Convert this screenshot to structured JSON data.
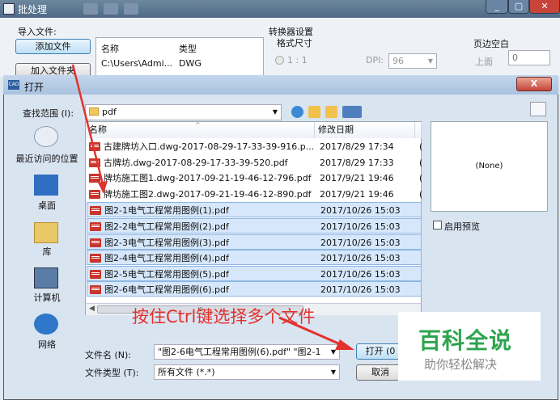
{
  "main_window": {
    "title": "批处理",
    "import_group_label": "导入文件:",
    "add_file_button": "添加文件",
    "add_folder_button": "加入文件夹",
    "list_headers": {
      "name": "名称",
      "type": "类型"
    },
    "list_rows": [
      {
        "name": "C:\\Users\\Admi...",
        "type": "DWG"
      }
    ],
    "converter_group_label": "转换器设置",
    "format_size_label": "格式尺寸",
    "ratio_label": "1 : 1",
    "dpi_label": "DPI:",
    "dpi_value": "96",
    "margin_label": "页边空白",
    "margin_top_label": "上面",
    "margin_top_value": "0"
  },
  "dialog": {
    "title": "打开",
    "close_label": "X",
    "lookin_label": "查找范围 (I):",
    "lookin_value": "pdf",
    "places": [
      {
        "label": "最近访问的位置",
        "icon": "recent-places-icon"
      },
      {
        "label": "桌面",
        "icon": "desktop-icon"
      },
      {
        "label": "库",
        "icon": "libraries-icon"
      },
      {
        "label": "计算机",
        "icon": "computer-icon"
      },
      {
        "label": "网络",
        "icon": "network-icon"
      }
    ],
    "columns": {
      "name": "名称",
      "date": "修改日期"
    },
    "files": [
      {
        "name": "古建牌坊入口.dwg-2017-08-29-17-33-39-916.p...",
        "date": "2017/8/29 17:34",
        "selected": false
      },
      {
        "name": "古牌坊.dwg-2017-08-29-17-33-39-520.pdf",
        "date": "2017/8/29 17:33",
        "selected": false
      },
      {
        "name": "牌坊施工图1.dwg-2017-09-21-19-46-12-796.pdf",
        "date": "2017/9/21 19:46",
        "selected": false
      },
      {
        "name": "牌坊施工图2.dwg-2017-09-21-19-46-12-890.pdf",
        "date": "2017/9/21 19:46",
        "selected": false
      },
      {
        "name": "图2-1电气工程常用图例(1).pdf",
        "date": "2017/10/26 15:03",
        "selected": true
      },
      {
        "name": "图2-2电气工程常用图例(2).pdf",
        "date": "2017/10/26 15:03",
        "selected": true
      },
      {
        "name": "图2-3电气工程常用图例(3).pdf",
        "date": "2017/10/26 15:03",
        "selected": true
      },
      {
        "name": "图2-4电气工程常用图例(4).pdf",
        "date": "2017/10/26 15:03",
        "selected": true
      },
      {
        "name": "图2-5电气工程常用图例(5).pdf",
        "date": "2017/10/26 15:03",
        "selected": true
      },
      {
        "name": "图2-6电气工程常用图例(6).pdf",
        "date": "2017/10/26 15:03",
        "selected": true
      }
    ],
    "preview_text": "(None)",
    "enable_preview_label": "启用预览",
    "filename_label": "文件名 (N):",
    "filename_value": "\"图2-6电气工程常用图例(6).pdf\" \"图2-1",
    "filetype_label": "文件类型 (T):",
    "filetype_value": "所有文件 (*.*)",
    "open_button": "打开 (0",
    "cancel_button": "取消",
    "scroll_grip": "III"
  },
  "annotation": {
    "hint_text": "按住Ctrl键选择多个文件",
    "color": "#e3312d"
  },
  "watermark": {
    "title": "百科全说",
    "subtitle": "助你轻松解决"
  },
  "colors": {
    "selection": "#d6e7fb",
    "title_bar": "#4e6a87",
    "accent_green": "#2ea44f"
  }
}
